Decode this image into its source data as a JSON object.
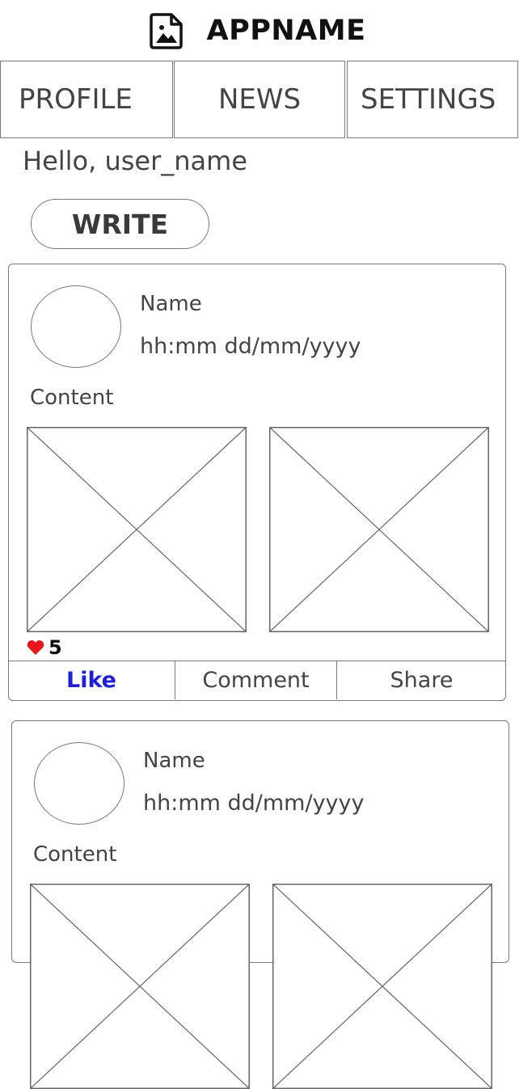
{
  "header": {
    "app_name": "APPNAME",
    "logo_icon": "image-file-icon"
  },
  "nav": {
    "tabs": [
      {
        "label": "PROFILE"
      },
      {
        "label": "NEWS"
      },
      {
        "label": "SETTINGS"
      }
    ]
  },
  "greeting": "Hello, user_name",
  "write_label": "WRITE",
  "posts": [
    {
      "name": "Name",
      "time": "hh:mm dd/mm/yyyy",
      "content": "Content",
      "like_count": "5",
      "actions": {
        "like": "Like",
        "comment": "Comment",
        "share": "Share"
      }
    },
    {
      "name": "Name",
      "time": "hh:mm dd/mm/yyyy",
      "content": "Content"
    }
  ],
  "colors": {
    "like_blue": "#1f1fd6",
    "heart_red": "#e8141c",
    "border_gray": "#7a7a7a"
  }
}
